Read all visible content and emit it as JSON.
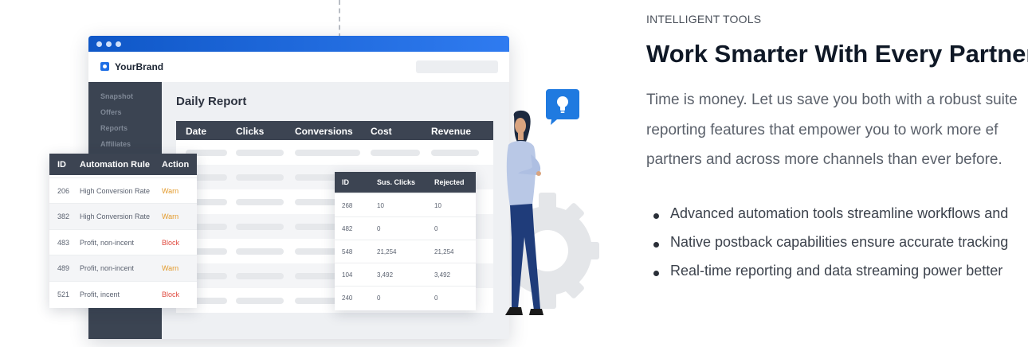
{
  "brand": {
    "name": "YourBrand"
  },
  "sidebar": {
    "items": [
      "Snapshot",
      "Offers",
      "Reports",
      "Affiliates"
    ]
  },
  "report": {
    "title": "Daily Report",
    "columns": [
      "Date",
      "Clicks",
      "Conversions",
      "Cost",
      "Revenue"
    ]
  },
  "automation": {
    "columns": [
      "ID",
      "Automation Rule",
      "Action"
    ],
    "rows": [
      {
        "id": "206",
        "rule": "High Conversion Rate",
        "action": "Warn"
      },
      {
        "id": "382",
        "rule": "High Conversion Rate",
        "action": "Warn"
      },
      {
        "id": "483",
        "rule": "Profit, non-incent",
        "action": "Block"
      },
      {
        "id": "489",
        "rule": "Profit, non-incent",
        "action": "Warn"
      },
      {
        "id": "521",
        "rule": "Profit, incent",
        "action": "Block"
      }
    ]
  },
  "suspicious": {
    "columns": [
      "ID",
      "Sus. Clicks",
      "Rejected"
    ],
    "rows": [
      {
        "id": "268",
        "clicks": "10",
        "rejected": "10"
      },
      {
        "id": "482",
        "clicks": "0",
        "rejected": "0"
      },
      {
        "id": "548",
        "clicks": "21,254",
        "rejected": "21,254"
      },
      {
        "id": "104",
        "clicks": "3,492",
        "rejected": "3,492"
      },
      {
        "id": "240",
        "clicks": "0",
        "rejected": "0"
      }
    ]
  },
  "copy": {
    "eyebrow": "INTELLIGENT TOOLS",
    "headline": "Work Smarter With Every Partner",
    "paragraph_lines": [
      "Time is money. Let us save you both with a robust suite",
      "reporting features that empower you to work more ef",
      "partners and across more channels than ever before."
    ],
    "bullets": [
      "Advanced automation tools streamline workflows and",
      "Native postback capabilities ensure accurate tracking",
      "Real-time reporting and data streaming power better"
    ]
  },
  "colors": {
    "accent": "#1f6fe5",
    "table_header": "#3c4452",
    "warn": "#e39b2d",
    "block": "#e04a3f"
  },
  "icons": [
    "lightbulb-icon",
    "gear-icon"
  ]
}
